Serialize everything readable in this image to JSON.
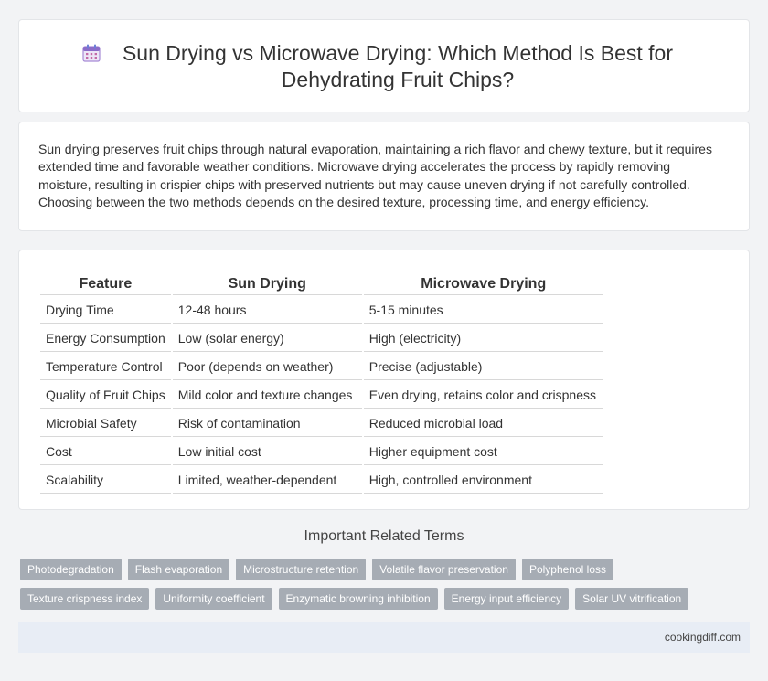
{
  "header": {
    "icon": "calendar-icon",
    "title": "Sun Drying vs Microwave Drying: Which Method Is Best for Dehydrating Fruit Chips?"
  },
  "intro": {
    "text": "Sun drying preserves fruit chips through natural evaporation, maintaining a rich flavor and chewy texture, but it requires extended time and favorable weather conditions. Microwave drying accelerates the process by rapidly removing moisture, resulting in crispier chips with preserved nutrients but may cause uneven drying if not carefully controlled. Choosing between the two methods depends on the desired texture, processing time, and energy efficiency."
  },
  "comparison": {
    "headers": [
      "Feature",
      "Sun Drying",
      "Microwave Drying"
    ],
    "rows": [
      [
        "Drying Time",
        "12-48 hours",
        "5-15 minutes"
      ],
      [
        "Energy Consumption",
        "Low (solar energy)",
        "High (electricity)"
      ],
      [
        "Temperature Control",
        "Poor (depends on weather)",
        "Precise (adjustable)"
      ],
      [
        "Quality of Fruit Chips",
        "Mild color and texture changes",
        "Even drying, retains color and crispness"
      ],
      [
        "Microbial Safety",
        "Risk of contamination",
        "Reduced microbial load"
      ],
      [
        "Cost",
        "Low initial cost",
        "Higher equipment cost"
      ],
      [
        "Scalability",
        "Limited, weather-dependent",
        "High, controlled environment"
      ]
    ]
  },
  "related": {
    "heading": "Important Related Terms",
    "row1": [
      "Photodegradation",
      "Flash evaporation",
      "Microstructure retention",
      "Volatile flavor preservation",
      "Polyphenol loss"
    ],
    "row2": [
      "Texture crispness index",
      "Uniformity coefficient",
      "Enzymatic browning inhibition",
      "Energy input efficiency",
      "Solar UV vitrification"
    ]
  },
  "footer": {
    "site": "cookingdiff.com"
  },
  "colors": {
    "page_bg": "#f2f3f5",
    "tag_bg": "#a6acb4",
    "footer_bg": "#e8edf5"
  }
}
